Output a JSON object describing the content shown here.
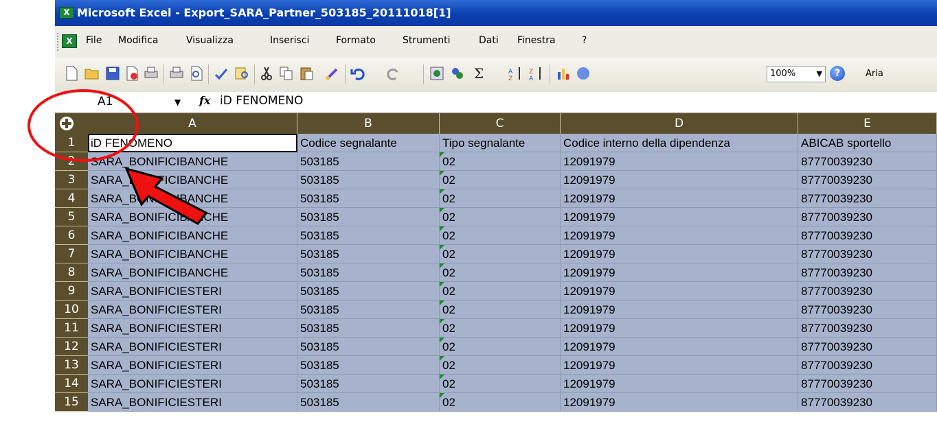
{
  "window": {
    "title": "Microsoft Excel - Export_SARA_Partner_503185_20111018[1]"
  },
  "menu": [
    "File",
    "Modifica",
    "Visualizza",
    "Inserisci",
    "Formato",
    "Strumenti",
    "Dati",
    "Finestra",
    "?"
  ],
  "toolbar": {
    "icons": [
      "new-icon",
      "open-icon",
      "save-icon",
      "permission-icon",
      "print-icon",
      "print-preview-icon",
      "spelling-icon",
      "research-icon",
      "cut-icon",
      "copy-icon",
      "paste-icon",
      "format-painter-icon",
      "undo-icon",
      "redo-icon",
      "hyperlink-icon",
      "autosum-icon",
      "sort-ascending-icon",
      "sort-descending-icon",
      "chart-wizard-icon",
      "drawing-icon"
    ],
    "zoom": "100%",
    "font": "Aria"
  },
  "formula_bar": {
    "name_box": "A1",
    "fx": "fx",
    "value": "iD FENOMENO"
  },
  "sheet": {
    "columns": [
      "A",
      "B",
      "C",
      "D",
      "E"
    ],
    "row_numbers": [
      "1",
      "2",
      "3",
      "4",
      "5",
      "6",
      "7",
      "8",
      "9",
      "10",
      "11",
      "12",
      "13",
      "14",
      "15"
    ],
    "rows": [
      [
        "iD FENOMENO",
        "Codice segnalante",
        "Tipo segnalante",
        "Codice interno della dipendenza",
        "ABICAB sportello"
      ],
      [
        "SARA_BONIFICIBANCHE",
        "503185",
        "02",
        "12091979",
        "87770039230"
      ],
      [
        "SARA_BONIFICIBANCHE",
        "503185",
        "02",
        "12091979",
        "87770039230"
      ],
      [
        "SARA_BONIFICIBANCHE",
        "503185",
        "02",
        "12091979",
        "87770039230"
      ],
      [
        "SARA_BONIFICIBANCHE",
        "503185",
        "02",
        "12091979",
        "87770039230"
      ],
      [
        "SARA_BONIFICIBANCHE",
        "503185",
        "02",
        "12091979",
        "87770039230"
      ],
      [
        "SARA_BONIFICIBANCHE",
        "503185",
        "02",
        "12091979",
        "87770039230"
      ],
      [
        "SARA_BONIFICIBANCHE",
        "503185",
        "02",
        "12091979",
        "87770039230"
      ],
      [
        "SARA_BONIFICIESTERI",
        "503185",
        "02",
        "12091979",
        "87770039230"
      ],
      [
        "SARA_BONIFICIESTERI",
        "503185",
        "02",
        "12091979",
        "87770039230"
      ],
      [
        "SARA_BONIFICIESTERI",
        "503185",
        "02",
        "12091979",
        "87770039230"
      ],
      [
        "SARA_BONIFICIESTERI",
        "503185",
        "02",
        "12091979",
        "87770039230"
      ],
      [
        "SARA_BONIFICIESTERI",
        "503185",
        "02",
        "12091979",
        "87770039230"
      ],
      [
        "SARA_BONIFICIESTERI",
        "503185",
        "02",
        "12091979",
        "87770039230"
      ],
      [
        "SARA_BONIFICIESTERI",
        "503185",
        "02",
        "12091979",
        "87770039230"
      ]
    ]
  },
  "colors": {
    "title_bar": "#0a3fb0",
    "header_bg": "#5b4e2d",
    "selection": "#a7b3cc",
    "annotation": "#ee1111"
  }
}
